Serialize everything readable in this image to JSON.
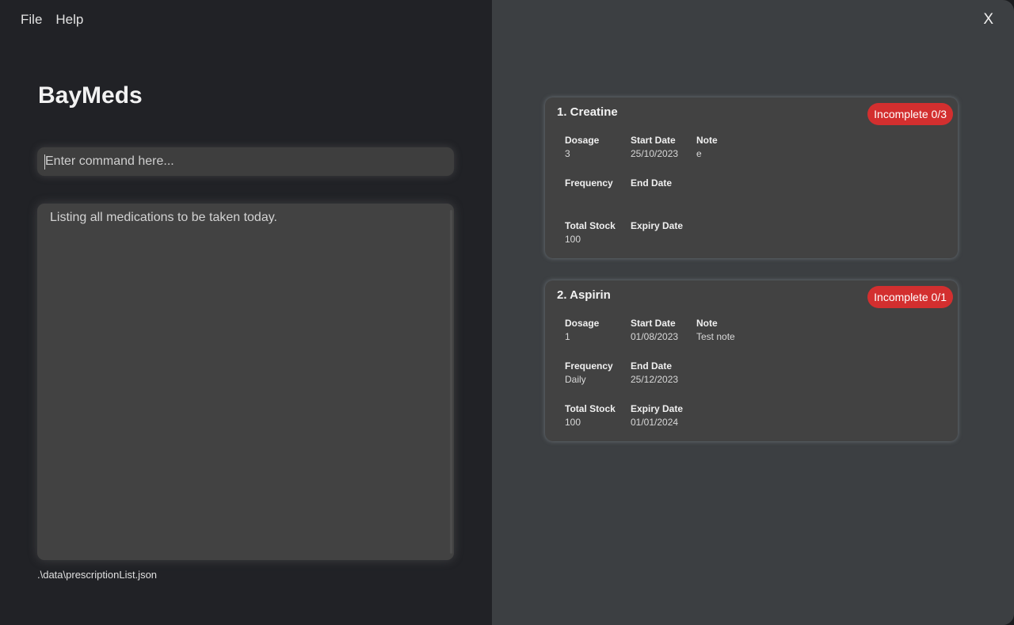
{
  "menu": {
    "file": "File",
    "help": "Help"
  },
  "app": {
    "title": "BayMeds",
    "close_label": "X"
  },
  "command": {
    "placeholder": "Enter command here...",
    "value": ""
  },
  "result": {
    "text": "Listing all medications to be taken today."
  },
  "status": {
    "path": ".\\data\\prescriptionList.json"
  },
  "colors": {
    "badge_incomplete": "#d32f2f",
    "left_bg": "#212226",
    "right_bg": "#3c3f42",
    "card_bg": "#424242"
  },
  "labels": {
    "dosage": "Dosage",
    "start_date": "Start Date",
    "note": "Note",
    "frequency": "Frequency",
    "end_date": "End Date",
    "total_stock": "Total Stock",
    "expiry_date": "Expiry Date"
  },
  "medications": [
    {
      "title": "1.  Creatine",
      "status": "Incomplete 0/3",
      "dosage": "3",
      "start_date": "25/10/2023",
      "note": "e",
      "frequency": "",
      "end_date": "",
      "total_stock": "100",
      "expiry_date": ""
    },
    {
      "title": "2.  Aspirin",
      "status": "Incomplete 0/1",
      "dosage": "1",
      "start_date": "01/08/2023",
      "note": "Test note",
      "frequency": "Daily",
      "end_date": "25/12/2023",
      "total_stock": "100",
      "expiry_date": "01/01/2024"
    }
  ]
}
